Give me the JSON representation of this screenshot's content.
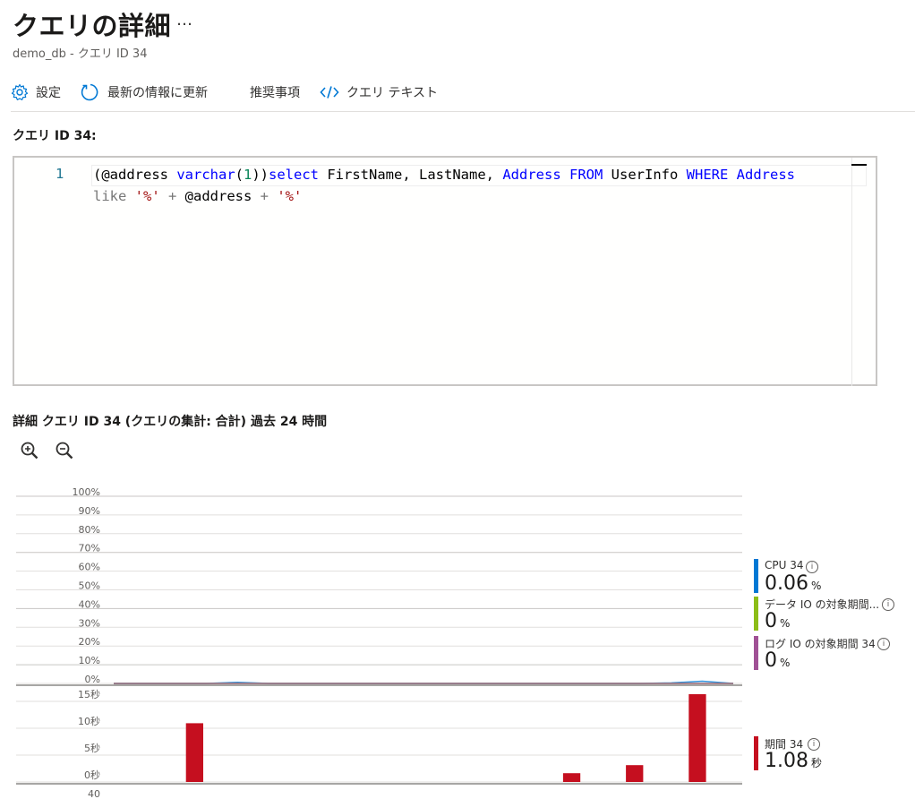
{
  "header": {
    "title": "クエリの詳細",
    "more": "…",
    "subtitle": "demo_db - クエリ ID 34"
  },
  "toolbar": {
    "settings_label": "設定",
    "refresh_label": "最新の情報に更新",
    "recommend_label": "推奨事項",
    "query_text_label": "クエリ テキスト"
  },
  "query": {
    "label": "クエリ ID 34:",
    "line_number": "1",
    "line1": {
      "p1": "(@address ",
      "kw1": "varchar",
      "p2": "(",
      "n1": "1",
      "p3": "))",
      "kw2": "select",
      "p4": " FirstName, LastName, ",
      "kw3": "Address",
      "p5": " ",
      "kw4": "FROM",
      "p6": " UserInfo ",
      "kw5": "WHERE",
      "p7": " ",
      "kw6": "Address"
    },
    "line2": {
      "op1": "like",
      "p1": " ",
      "s1": "'%'",
      "op2": " + ",
      "p2": "@address",
      "op3": " + ",
      "s2": "'%'"
    }
  },
  "details": {
    "label": "詳細 クエリ ID 34 (クエリの集計: 合計) 過去 24 時間"
  },
  "zoom": {
    "in": "zoom-in",
    "out": "zoom-out"
  },
  "chart_data": [
    {
      "type": "area",
      "ylabel": "",
      "ylim": [
        0,
        100
      ],
      "y_ticks": [
        "100%",
        "90%",
        "80%",
        "70%",
        "60%",
        "50%",
        "40%",
        "30%",
        "20%",
        "10%",
        "0%"
      ],
      "series": [
        {
          "name": "CPU 34",
          "color": "#0078d4",
          "values": [
            0,
            0,
            0,
            0,
            0.6,
            0,
            0,
            0,
            0,
            0,
            0,
            0,
            0,
            0,
            0,
            0,
            0,
            0,
            0.3,
            1.2,
            0
          ]
        },
        {
          "name": "データ IO の対象期間 34",
          "color": "#8cbd18",
          "values": [
            0,
            0,
            0,
            0,
            0,
            0,
            0,
            0,
            0,
            0,
            0,
            0,
            0,
            0,
            0,
            0,
            0,
            0,
            0,
            0,
            0
          ]
        },
        {
          "name": "ログ IO の対象期間 34",
          "color": "#a05195",
          "values": [
            0,
            0,
            0,
            0,
            0,
            0,
            0,
            0,
            0,
            0,
            0,
            0,
            0,
            0,
            0,
            0,
            0,
            0,
            0,
            0,
            0
          ]
        }
      ]
    },
    {
      "type": "bar",
      "ylim": [
        0,
        15
      ],
      "y_ticks": [
        "15秒",
        "10秒",
        "5秒",
        "0秒"
      ],
      "series": [
        {
          "name": "期間 34",
          "color": "#c50f1f",
          "values": [
            0,
            0,
            9.6,
            0,
            0,
            0,
            0,
            0,
            0,
            0,
            0,
            0,
            0,
            0,
            0.3,
            0,
            1.8,
            0,
            15.0,
            0
          ]
        }
      ]
    }
  ],
  "chart_extra": {
    "next_axis_label": "40"
  },
  "legend": [
    {
      "name": "CPU 34",
      "value": "0.06",
      "unit": "%",
      "color": "#0078d4"
    },
    {
      "name": "データ IO の対象期間...",
      "value": "0",
      "unit": "%",
      "color": "#8cbd18"
    },
    {
      "name": "ログ IO の対象期間 34",
      "value": "0",
      "unit": "%",
      "color": "#a05195"
    },
    {
      "name": "期間 34",
      "value": "1.08",
      "unit": "秒",
      "color": "#c50f1f"
    }
  ],
  "info_icon": "i"
}
